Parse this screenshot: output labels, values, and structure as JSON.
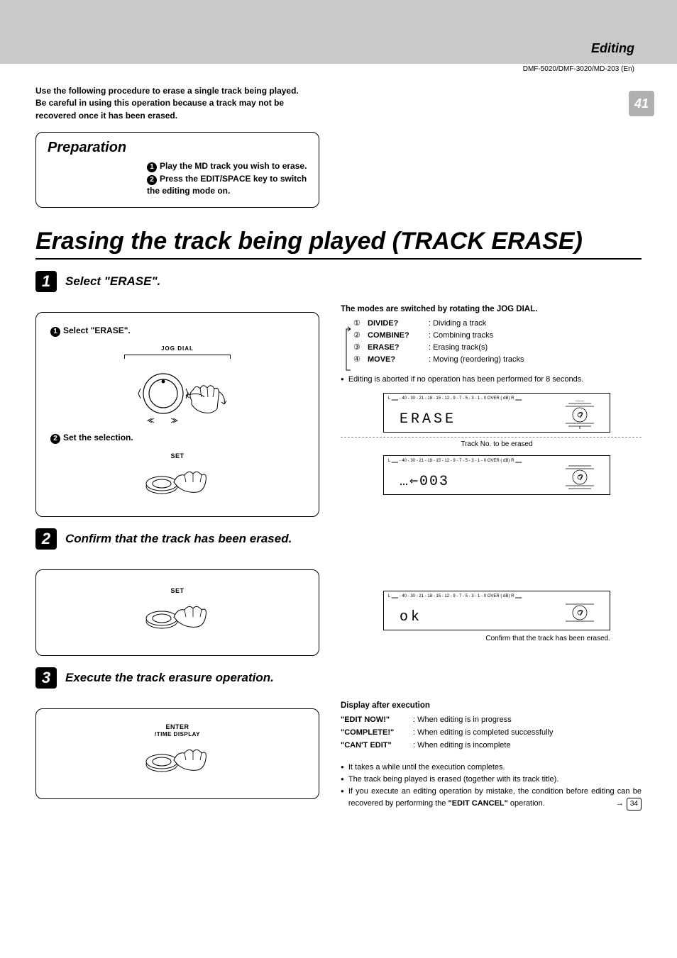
{
  "header": {
    "category": "Editing",
    "models": "DMF-5020/DMF-3020/MD-203 (En)",
    "pageNumber": "41"
  },
  "intro": {
    "line1": "Use the following procedure to erase a single track being played.",
    "line2": "Be careful in using this operation because a track may not be recovered once it has been erased."
  },
  "preparation": {
    "title": "Preparation",
    "items": {
      "i1": "Play the MD track you wish to erase.",
      "i2": "Press the EDIT/SPACE key to switch the editing mode on."
    }
  },
  "bigTitle": "Erasing the track being played (TRACK ERASE)",
  "step1": {
    "label": "Select \"ERASE\".",
    "sub1": "Select \"ERASE\".",
    "jogLabel": "JOG DIAL",
    "sub2": "Set the selection.",
    "setLabel": "SET"
  },
  "right1": {
    "heading": "The modes are switched by rotating the JOG DIAL.",
    "modes": {
      "m1": {
        "name": "DIVIDE?",
        "desc": ":  Dividing a track"
      },
      "m2": {
        "name": "COMBINE?",
        "desc": ":  Combining tracks"
      },
      "m3": {
        "name": "ERASE?",
        "desc": ":  Erasing track(s)"
      },
      "m4": {
        "name": "MOVE?",
        "desc": ":  Moving (reordering) tracks"
      }
    },
    "bullet": "Editing is aborted if no operation has been performed for 8 seconds.",
    "meter": "L ▁▁  - 40 - 30 - 21 - 18 - 15 - 12 - 9  - 7  - 5  - 3  - 1  - 0  OVER ( dB)   R ▁▁",
    "lcd1": "ERASE",
    "lcd2": "…⇐003",
    "noteBetween": "Track No. to be erased"
  },
  "step2": {
    "label": "Confirm that the track has been erased.",
    "setLabel": "SET"
  },
  "right2": {
    "lcd": "ok",
    "note": "Confirm that the track has been erased."
  },
  "step3": {
    "label": "Execute the track erasure operation.",
    "enterLabel1": "ENTER",
    "enterLabel2": "/TIME DISPLAY"
  },
  "right3": {
    "heading": "Display after execution",
    "displays": {
      "d1": {
        "name": "\"EDIT NOW!\"",
        "desc": ":  When editing is in progress"
      },
      "d2": {
        "name": "\"COMPLETE!\"",
        "desc": ":  When editing is completed successfully"
      },
      "d3": {
        "name": "\"CAN'T EDIT\"",
        "desc": ":  When editing is incomplete"
      }
    },
    "bullets": {
      "b1": "It takes a while until the execution completes.",
      "b2": "The track being played is erased (together with its track title).",
      "b3a": "If you execute an editing operation by mistake, the condition before editing can be recovered by performing the ",
      "b3b": "\"EDIT CANCEL\"",
      "b3c": " operation.",
      "pageref": "34"
    }
  }
}
